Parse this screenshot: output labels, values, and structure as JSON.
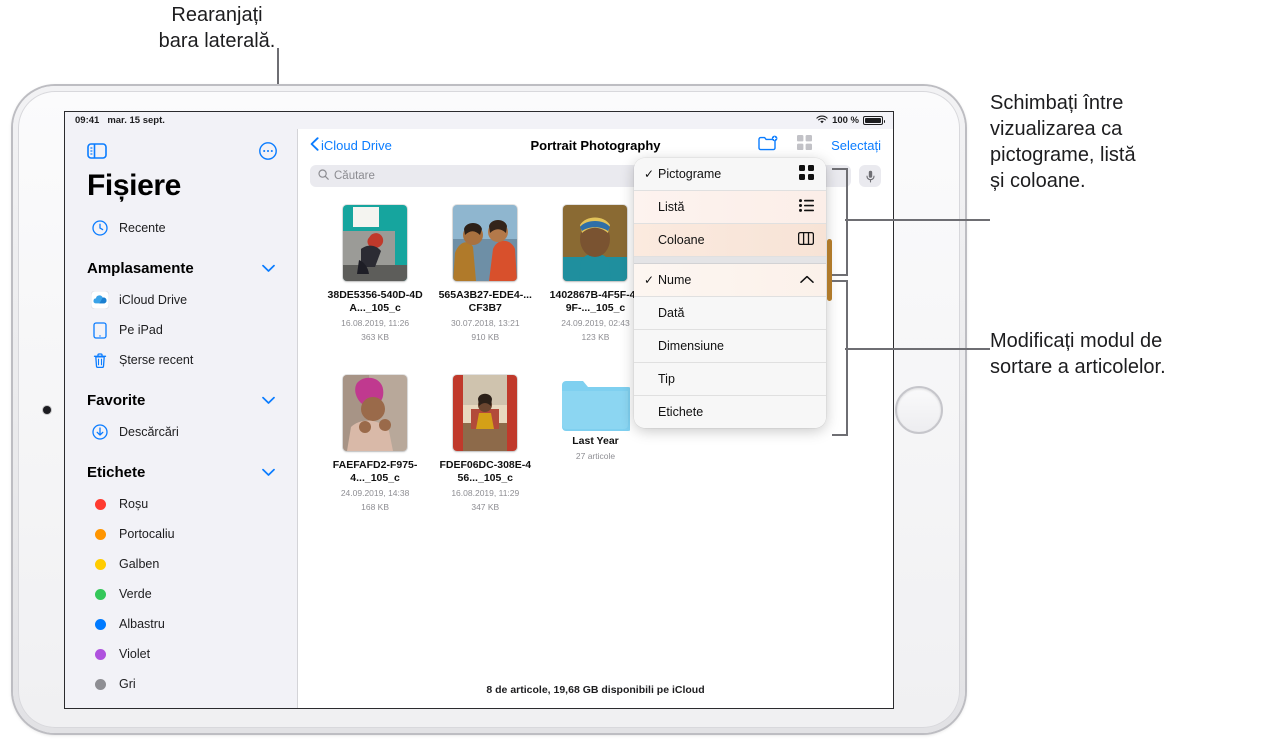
{
  "callouts": {
    "left": "Rearanjați\nbara laterală.",
    "right_top": "Schimbați între\nvizualizarea ca\npictograme, listă\nși coloane.",
    "right_bottom": "Modificați modul de\nsortare a articolelor."
  },
  "status_bar": {
    "time": "09:41",
    "date": "mar. 15 sept.",
    "battery_percent": "100 %",
    "wifi_icon": "wifi-icon",
    "battery_icon": "battery-icon"
  },
  "sidebar": {
    "title": "Fișiere",
    "toggle_icon": "sidebar-toggle-icon",
    "more_icon": "more-options-icon",
    "recent": {
      "label": "Recente",
      "icon": "clock-icon"
    },
    "sections": [
      {
        "label": "Amplasamente",
        "chevron": "chevron-down-icon",
        "items": [
          {
            "label": "iCloud Drive",
            "icon": "icloud-icon"
          },
          {
            "label": "Pe iPad",
            "icon": "ipad-icon"
          },
          {
            "label": "Șterse recent",
            "icon": "trash-icon"
          }
        ]
      },
      {
        "label": "Favorite",
        "chevron": "chevron-down-icon",
        "items": [
          {
            "label": "Descărcări",
            "icon": "download-icon"
          }
        ]
      },
      {
        "label": "Etichete",
        "chevron": "chevron-down-icon",
        "items": [
          {
            "label": "Roșu",
            "icon": "tag-dot-icon",
            "color": "#ff3b30"
          },
          {
            "label": "Portocaliu",
            "icon": "tag-dot-icon",
            "color": "#ff9500"
          },
          {
            "label": "Galben",
            "icon": "tag-dot-icon",
            "color": "#ffcc00"
          },
          {
            "label": "Verde",
            "icon": "tag-dot-icon",
            "color": "#34c759"
          },
          {
            "label": "Albastru",
            "icon": "tag-dot-icon",
            "color": "#007aff"
          },
          {
            "label": "Violet",
            "icon": "tag-dot-icon",
            "color": "#af52de"
          },
          {
            "label": "Gri",
            "icon": "tag-dot-icon",
            "color": "#8e8e93"
          }
        ]
      }
    ]
  },
  "navbar": {
    "back_label": "iCloud Drive",
    "back_icon": "chevron-left-icon",
    "title": "Portrait Photography",
    "new_folder_icon": "new-folder-icon",
    "view_options_icon": "grid-view-icon",
    "select_label": "Selectați"
  },
  "search": {
    "placeholder": "Căutare",
    "value": "",
    "search_icon": "search-icon",
    "dictate_icon": "microphone-icon"
  },
  "view_menu": {
    "view_options": [
      {
        "label": "Pictograme",
        "checked": true,
        "icon": "grid-icon"
      },
      {
        "label": "Listă",
        "checked": false,
        "icon": "list-icon"
      },
      {
        "label": "Coloane",
        "checked": false,
        "icon": "columns-icon"
      }
    ],
    "sort_options": [
      {
        "label": "Nume",
        "checked": true,
        "icon": "chevron-up-icon"
      },
      {
        "label": "Dată",
        "checked": false,
        "icon": ""
      },
      {
        "label": "Dimensiune",
        "checked": false,
        "icon": ""
      },
      {
        "label": "Tip",
        "checked": false,
        "icon": ""
      },
      {
        "label": "Etichete",
        "checked": false,
        "icon": ""
      }
    ]
  },
  "files": [
    {
      "name": "38DE5356-540D-4DA..._105_c",
      "date": "16.08.2019, 11:26",
      "size": "363 KB",
      "type": "image",
      "palette": [
        "#1aa7a0",
        "#f2f2ee",
        "#9a9a96",
        "#c0392b",
        "#2b2b33"
      ]
    },
    {
      "name": "565A3B27-EDE4-...CF3B7",
      "date": "30.07.2018, 13:21",
      "size": "910 KB",
      "type": "image",
      "palette": [
        "#8fb6cf",
        "#b07a2a",
        "#d8502c",
        "#3a2a22",
        "#e8c9a8"
      ]
    },
    {
      "name": "1402867B-4F5F-489F-..._105_c",
      "date": "24.09.2019, 02:43",
      "size": "123 KB",
      "type": "image",
      "palette": [
        "#8a6a33",
        "#1f8f9e",
        "#e2c35a",
        "#6b4a2f",
        "#3b2b1f"
      ]
    },
    {
      "name": "FAEFAFD2-F975-4..._105_c",
      "date": "24.09.2019, 14:38",
      "size": "168 KB",
      "type": "image",
      "palette": [
        "#b33b8a",
        "#c9a89a",
        "#d9c9b8",
        "#8c7c6c",
        "#e86fb0"
      ]
    },
    {
      "name": "FDEF06DC-308E-456..._105_c",
      "date": "16.08.2019, 11:29",
      "size": "347 KB",
      "type": "image",
      "palette": [
        "#c0392b",
        "#e8d9c0",
        "#7a5a3a",
        "#d4a017",
        "#2b2b33"
      ]
    },
    {
      "name": "Last Year",
      "date": "27 articole",
      "size": "",
      "type": "folder",
      "palette": [
        "#7fd0f0",
        "#58bfe8"
      ]
    }
  ],
  "footer": {
    "status": "8 de articole, 19,68 GB disponibili pe iCloud"
  },
  "colors": {
    "accent": "#0a7cff",
    "sidebar_bg": "#f2f2f7",
    "menu_bg": "#f7f7f7",
    "callout_line": "#6e6e73"
  }
}
